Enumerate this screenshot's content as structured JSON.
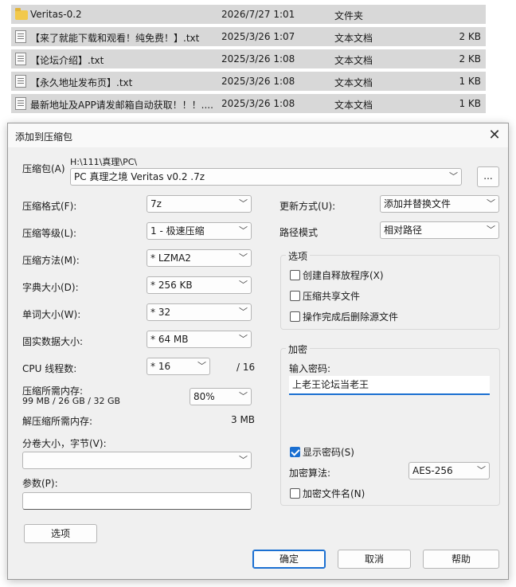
{
  "files": [
    {
      "name": "Veritas-0.2",
      "date": "2026/7/27 1:01",
      "type": "文件夹",
      "size": "",
      "icon": "folder-icon"
    },
    {
      "name": "【来了就能下载和观看！纯免费！】.txt",
      "date": "2025/3/26 1:07",
      "type": "文本文档",
      "size": "2 KB",
      "icon": "text-file-icon"
    },
    {
      "name": "【论坛介绍】.txt",
      "date": "2025/3/26 1:08",
      "type": "文本文档",
      "size": "2 KB",
      "icon": "text-file-icon"
    },
    {
      "name": "【永久地址发布页】.txt",
      "date": "2025/3/26 1:08",
      "type": "文本文档",
      "size": "1 KB",
      "icon": "text-file-icon"
    },
    {
      "name": "最新地址及APP请发邮箱自动获取！！！....",
      "date": "2025/3/26 1:08",
      "type": "文本文档",
      "size": "1 KB",
      "icon": "text-file-icon"
    }
  ],
  "dialog": {
    "title": "添加到压缩包",
    "close": "✕",
    "archive_label": "压缩包(A)",
    "archive_path": "H:\\111\\真理\\PC\\",
    "archive_name": "PC 真理之境 Veritas v0.2 .7z",
    "browse": "...",
    "format_label": "压缩格式(F):",
    "format_value": "7z",
    "level_label": "压缩等级(L):",
    "level_value": "1 - 极速压缩",
    "method_label": "压缩方法(M):",
    "method_value": "*  LZMA2",
    "dict_label": "字典大小(D):",
    "dict_value": "*  256 KB",
    "word_label": "单词大小(W):",
    "word_value": "*  32",
    "solid_label": "固实数据大小:",
    "solid_value": "*  64 MB",
    "threads_label": "CPU 线程数:",
    "threads_value": "*  16",
    "threads_total": "/ 16",
    "mem_label": "压缩所需内存:",
    "mem_detail": "99 MB / 26 GB / 32 GB",
    "mem_percent": "80%",
    "decomp_label": "解压缩所需内存:",
    "decomp_value": "3 MB",
    "split_label": "分卷大小，字节(V):",
    "split_value": "",
    "params_label": "参数(P):",
    "params_value": "",
    "options_button": "选项",
    "update_label": "更新方式(U):",
    "update_value": "添加并替换文件",
    "pathmode_label": "路径模式",
    "pathmode_value": "相对路径",
    "options_group": "选项",
    "opt_sfx": "创建自释放程序(X)",
    "opt_shared": "压缩共享文件",
    "opt_delete": "操作完成后删除源文件",
    "encrypt_group": "加密",
    "pw_label": "输入密码:",
    "pw_value": "上老王论坛当老王",
    "show_pw": "显示密码(S)",
    "enc_method_label": "加密算法:",
    "enc_method_value": "AES-256",
    "enc_names": "加密文件名(N)",
    "ok": "确定",
    "cancel": "取消",
    "help": "帮助",
    "chevron": "﹀"
  }
}
